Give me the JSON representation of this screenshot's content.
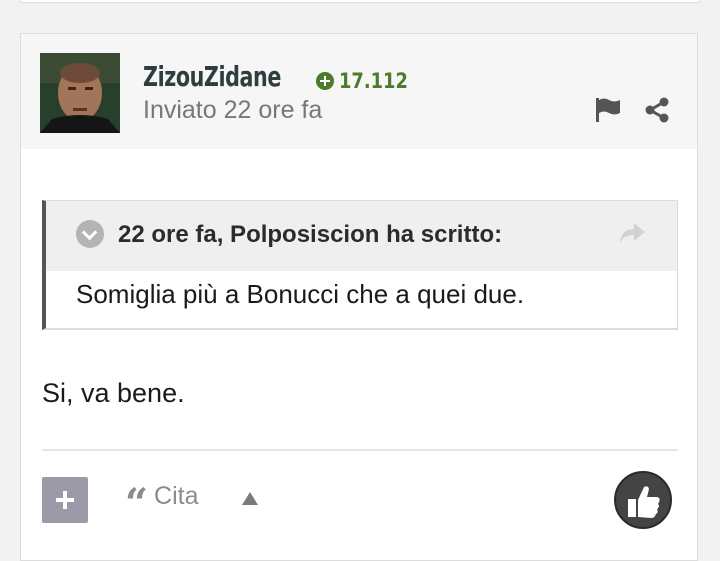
{
  "post": {
    "author": {
      "username": "ZizouZidane",
      "reputation": "17.112"
    },
    "posted": "Inviato 22 ore fa",
    "header_icons": [
      "flag-icon",
      "share-icon"
    ],
    "quote": {
      "citation": "22 ore fa, Polposiscion ha scritto:",
      "text": "Somiglia più a Bonucci che a quei due."
    },
    "body": "Si, va bene.",
    "actions": {
      "cite_label": "Cita",
      "icons": [
        "plus-icon",
        "quote-icon",
        "caret-up-icon",
        "thumbs-up-icon"
      ]
    }
  },
  "colors": {
    "username": "#2e3e3e",
    "reputation": "#4d7a2c",
    "header_bg": "#f6f6f6",
    "quote_border": "#555555",
    "add_button": "#9a9aa8",
    "like_button": "#444444"
  }
}
